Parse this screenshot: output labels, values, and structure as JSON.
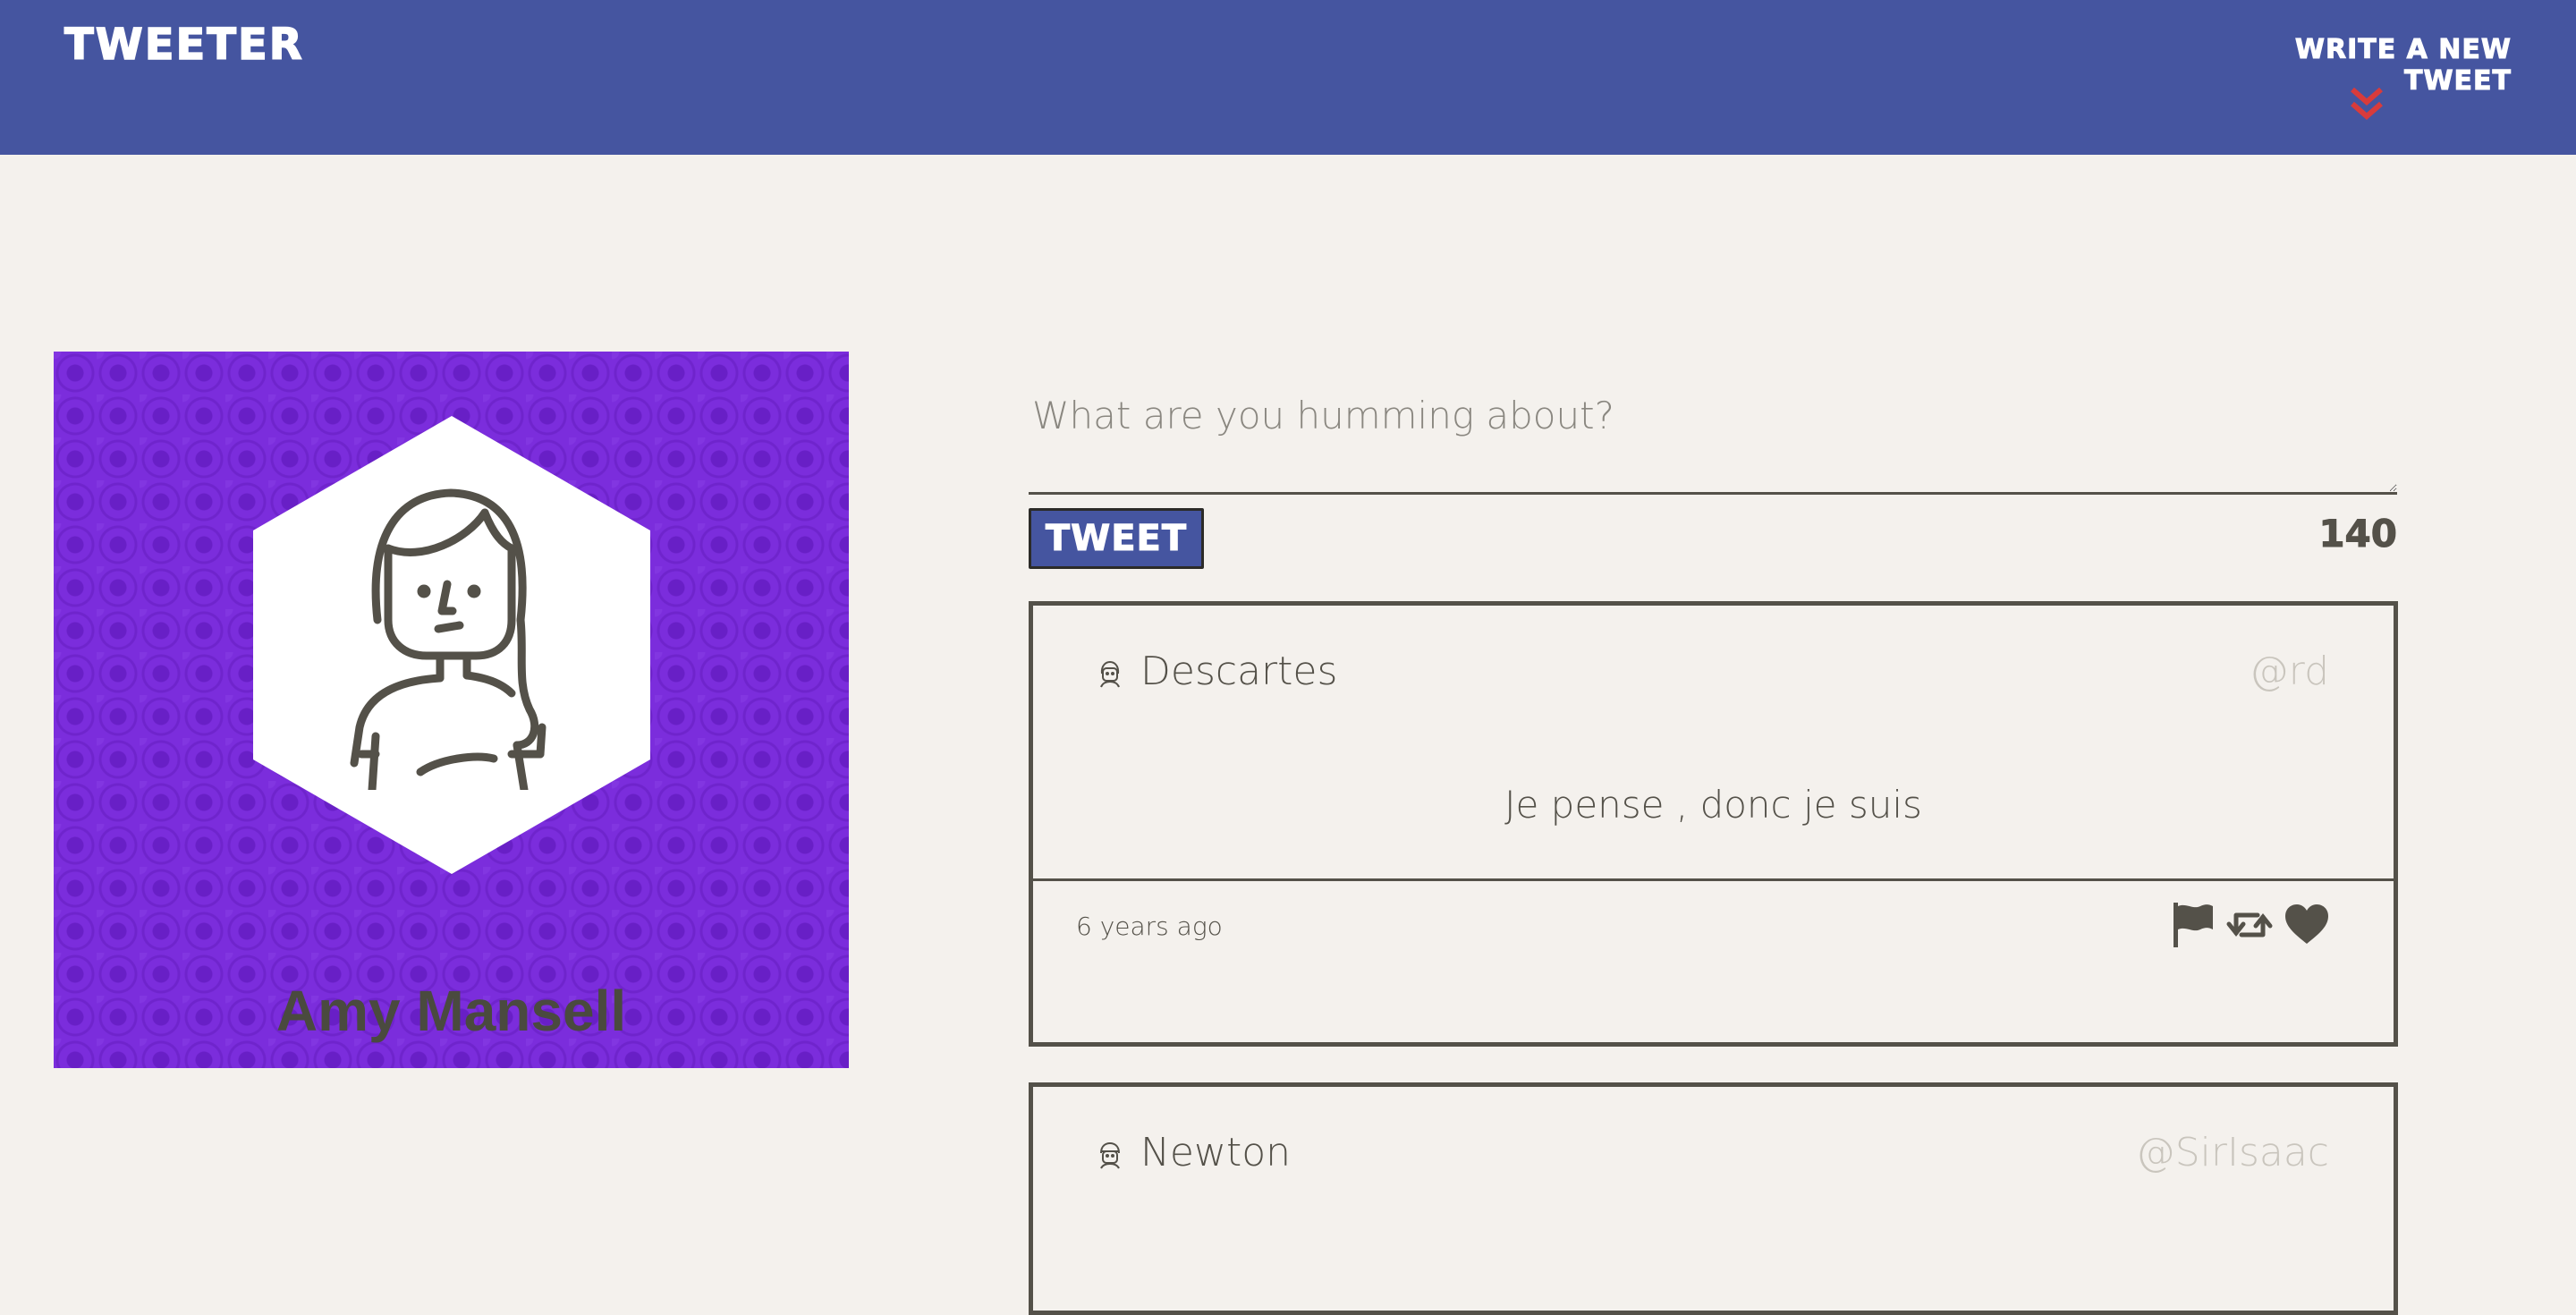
{
  "nav": {
    "brand": "TWEETER",
    "compose_toggle_label": "WRITE A NEW TWEET",
    "chevron_icon": "double-chevron-down-icon",
    "chevron_color": "#d93b3b",
    "background": "#4555a0"
  },
  "profile": {
    "name": "Amy Mansell",
    "background_color": "#7b2ddc",
    "avatar_icon": "woman-avatar-icon"
  },
  "compose": {
    "placeholder": "What are you humming about?",
    "value": "",
    "submit_label": "TWEET",
    "char_count": "140"
  },
  "tweets": [
    {
      "author": "Descartes",
      "handle": "@rd",
      "body": "Je pense , donc je suis",
      "time": "6 years ago",
      "actions": [
        "flag-icon",
        "retweet-icon",
        "heart-icon"
      ]
    },
    {
      "author": "Newton",
      "handle": "@SirIsaac",
      "body": "",
      "time": "",
      "actions": []
    }
  ],
  "colors": {
    "page_background": "#f4f1ed",
    "text": "#545149",
    "handle": "#c9c5bd",
    "accent": "#4555a0"
  }
}
